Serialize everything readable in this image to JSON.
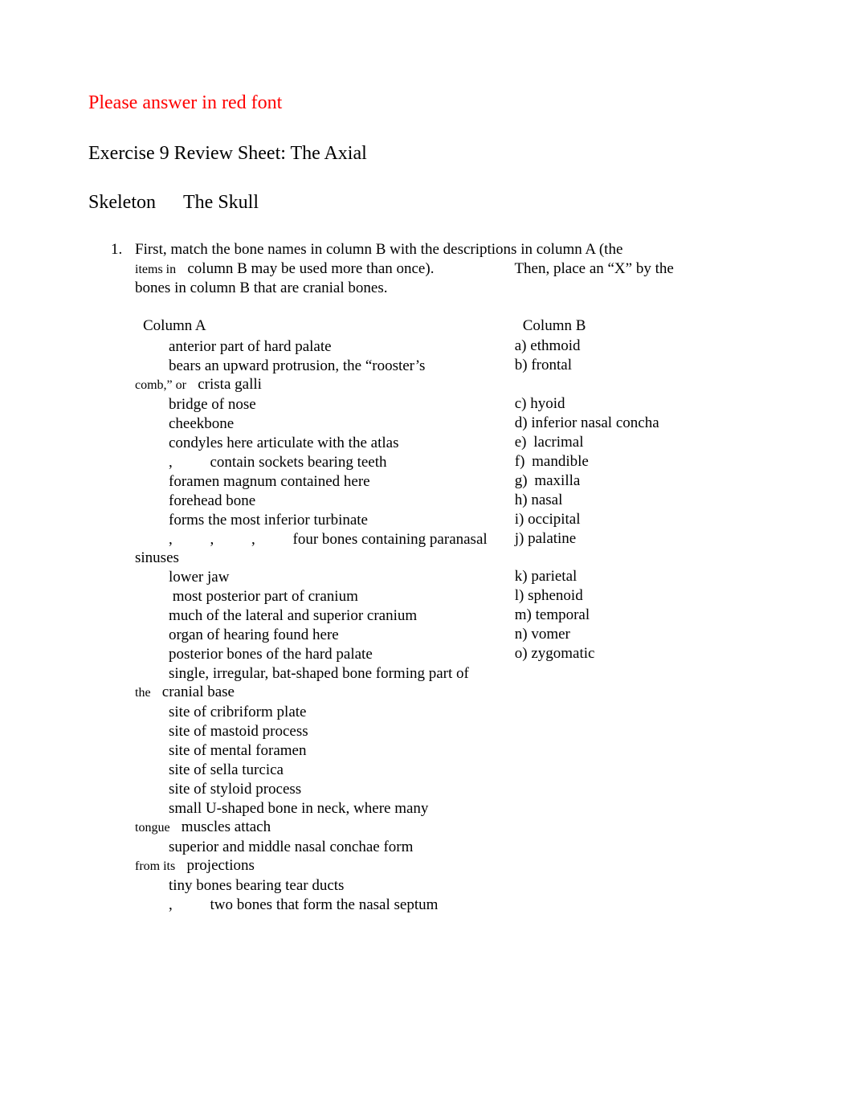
{
  "instruction_red": "Please answer in red font",
  "title_line1": "Exercise 9 Review Sheet: The Axial",
  "title_line2a": "Skeleton",
  "title_line2b": "The Skull",
  "q1_num": "1.",
  "q1_line1": "First, match the bone names in column B with the descriptions in column A (the",
  "q1_line2_itemsin": "items in",
  "q1_line2_a": "column B may be used more than once).",
  "q1_line2_b": "Then, place an “X” by the",
  "q1_line3": "bones in column B that are cranial bones.",
  "colA_header": "Column A",
  "colB_header": "Column B",
  "colA": {
    "r0": "anterior part of hard palate",
    "r1": "bears an upward protrusion, the “rooster’s",
    "r1c_a": "comb,” or",
    "r1c_b": "crista galli",
    "r2": "bridge of nose",
    "r3": "cheekbone",
    "r4": "condyles here articulate with the atlas",
    "r5": "contain sockets bearing teeth",
    "r6": "foramen magnum contained here",
    "r7": "forehead bone",
    "r8": "forms the most inferior turbinate",
    "r9": "four bones containing paranasal",
    "r9c": "sinuses",
    "r10": "lower jaw",
    "r11": " most posterior part of cranium",
    "r12": "much of the lateral and superior cranium",
    "r13": "organ of hearing found here",
    "r14": "posterior bones of the hard palate",
    "r15": "single, irregular, bat-shaped bone forming part of",
    "r15c_a": "the",
    "r15c_b": "cranial base",
    "r16": "site of cribriform plate",
    "r17": "site of mastoid process",
    "r18": "site of mental foramen",
    "r19": "site of sella turcica",
    "r20": "site of styloid process",
    "r21": "small U-shaped bone in neck, where many",
    "r21c_a": "tongue",
    "r21c_b": "muscles attach",
    "r22": "superior and middle nasal conchae form",
    "r22c_a": "from its",
    "r22c_b": "projections",
    "r23": "tiny bones bearing tear ducts",
    "r24": "two bones that form the nasal septum"
  },
  "colB": {
    "a": "a) ethmoid",
    "b": "b) frontal",
    "c": "c) hyoid",
    "d": "d) inferior nasal concha",
    "e_letter": "e)",
    "e_text": "lacrimal",
    "f_letter": "f)",
    "f_text": "mandible",
    "g_letter": "g)",
    "g_text": "maxilla",
    "h": "h) nasal",
    "i": "i) occipital",
    "j": "j) palatine",
    "k": "k) parietal",
    "l": "l) sphenoid",
    "m": "m) temporal",
    "n": "n) vomer",
    "o": "o) zygomatic"
  },
  "sep_comma": ","
}
